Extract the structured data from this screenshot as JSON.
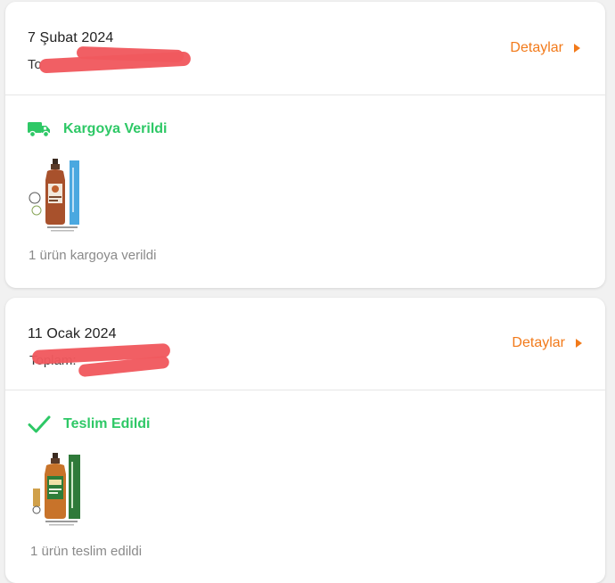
{
  "orders": [
    {
      "date": "7 Şubat 2024",
      "total_label": "To",
      "details_label": "Detaylar",
      "status": "Kargoya Verildi",
      "status_icon": "truck-icon",
      "status_color": "#2ec866",
      "summary": "1 ürün kargoya verildi"
    },
    {
      "date": "11 Ocak 2024",
      "total_label": "Toplam:",
      "details_label": "Detaylar",
      "status": "Teslim Edildi",
      "status_icon": "check-icon",
      "status_color": "#2ec866",
      "summary": "1 ürün teslim edildi"
    }
  ],
  "colors": {
    "accent": "#f27a1a",
    "success": "#2ec866",
    "redaction": "#f0585e"
  }
}
